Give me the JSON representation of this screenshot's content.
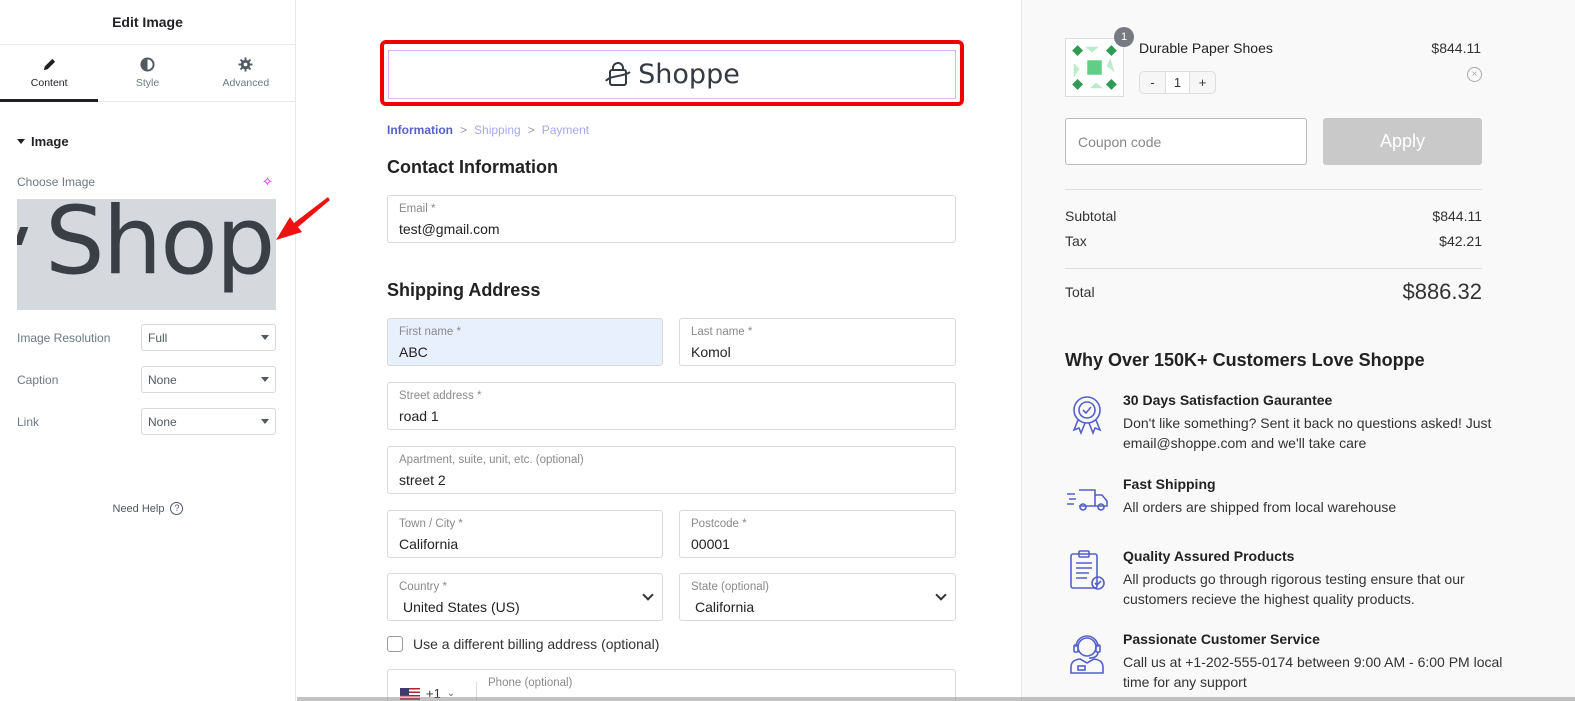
{
  "editor": {
    "title": "Edit Image",
    "tabs": [
      {
        "label": "Content",
        "icon": "pencil-icon",
        "active": true
      },
      {
        "label": "Style",
        "icon": "half-circle-icon",
        "active": false
      },
      {
        "label": "Advanced",
        "icon": "gear-icon",
        "active": false
      }
    ],
    "section_title": "Image",
    "choose_image_label": "Choose Image",
    "preview_text": "Shopp",
    "controls": [
      {
        "label": "Image Resolution",
        "value": "Full"
      },
      {
        "label": "Caption",
        "value": "None"
      },
      {
        "label": "Link",
        "value": "None"
      }
    ],
    "need_help": "Need Help",
    "help_icon_glyph": "?",
    "collapse_glyph": "‹"
  },
  "checkout": {
    "logo_text": "Shoppe",
    "breadcrumb": [
      {
        "label": "Information",
        "active": true
      },
      {
        "label": "Shipping",
        "active": false
      },
      {
        "label": "Payment",
        "active": false
      }
    ],
    "breadcrumb_sep": ">",
    "contact_title": "Contact Information",
    "shipping_title": "Shipping Address",
    "fields": {
      "email": {
        "label": "Email *",
        "value": "test@gmail.com"
      },
      "first_name": {
        "label": "First name *",
        "value": "ABC"
      },
      "last_name": {
        "label": "Last name *",
        "value": "Komol"
      },
      "street": {
        "label": "Street address *",
        "value": "road 1"
      },
      "apartment": {
        "label": "Apartment, suite, unit, etc. (optional)",
        "value": "street 2"
      },
      "city": {
        "label": "Town / City *",
        "value": "California"
      },
      "postcode": {
        "label": "Postcode *",
        "value": "00001"
      },
      "country": {
        "label": "Country *",
        "value": "United States (US)"
      },
      "state": {
        "label": "State (optional)",
        "value": "California"
      }
    },
    "billing_checkbox_label": "Use a different billing address (optional)",
    "phone": {
      "dial_code": "+1",
      "label": "Phone (optional)"
    }
  },
  "summary": {
    "item": {
      "name": "Durable Paper Shoes",
      "price": "$844.11",
      "quantity": "1",
      "badge": "1",
      "minus": "-",
      "plus": "+",
      "remove_glyph": "×"
    },
    "coupon_placeholder": "Coupon code",
    "apply_label": "Apply",
    "subtotal_label": "Subtotal",
    "subtotal_value": "$844.11",
    "tax_label": "Tax",
    "tax_value": "$42.21",
    "total_label": "Total",
    "total_value": "$886.32",
    "why_title": "Why Over 150K+ Customers Love Shoppe",
    "features": [
      {
        "icon": "badge-check-icon",
        "title": "30 Days Satisfaction Gaurantee",
        "desc": "Don't like something? Sent it back no questions asked! Just email@shoppe.com and we'll take care"
      },
      {
        "icon": "truck-icon",
        "title": "Fast Shipping",
        "desc": "All orders are shipped from local warehouse"
      },
      {
        "icon": "clipboard-check-icon",
        "title": "Quality Assured Products",
        "desc": "All products go through rigorous testing ensure that our customers recieve the highest quality products."
      },
      {
        "icon": "support-agent-icon",
        "title": "Passionate Customer Service",
        "desc": "Call us at +1-202-555-0174 between 9:00 AM - 6:00 PM local time for any support"
      }
    ],
    "accent_color": "#5461c8"
  }
}
